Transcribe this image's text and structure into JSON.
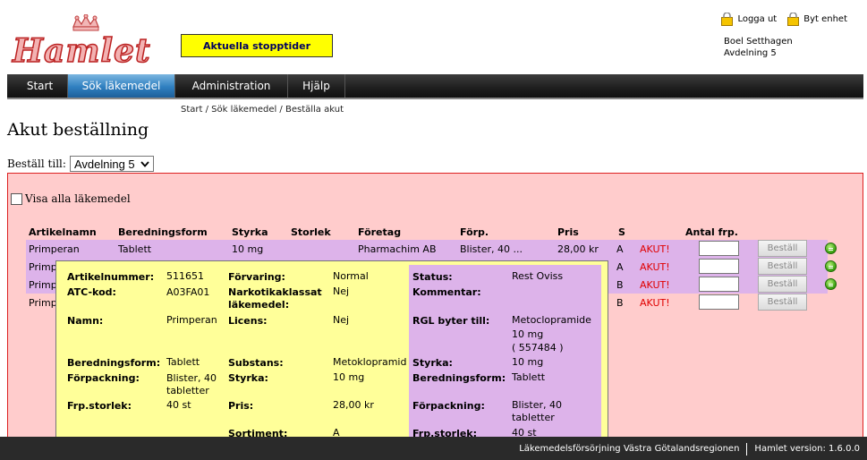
{
  "header": {
    "logo_text": "Hamlet",
    "stop_button": "Aktuella stopptider",
    "logout": "Logga ut",
    "switch_unit": "Byt enhet",
    "user_name": "Boel Setthagen",
    "user_unit": "Avdelning 5"
  },
  "nav": {
    "items": [
      {
        "label": "Start"
      },
      {
        "label": "Sök läkemedel"
      },
      {
        "label": "Administration"
      },
      {
        "label": "Hjälp"
      }
    ]
  },
  "breadcrumb": "Start / Sök läkemedel / Beställa akut",
  "page_title": "Akut beställning",
  "order_to": {
    "label": "Beställ till:",
    "selected": "Avdelning 5"
  },
  "show_all": "Visa alla läkemedel",
  "table": {
    "headers": {
      "artikelnamn": "Artikelnamn",
      "beredningsform": "Beredningsform",
      "styrka": "Styrka",
      "storlek": "Storlek",
      "foretag": "Företag",
      "forp": "Förp.",
      "pris": "Pris",
      "s": "S",
      "antal": "Antal frp."
    },
    "rows": [
      {
        "name": "Primperan",
        "form": "Tablett",
        "strength": "10 mg",
        "company": "Pharmachim AB",
        "pack": "Blister, 40 ...",
        "price": "28,00 kr",
        "s": "A",
        "akut": "AKUT!",
        "button": "Beställ"
      },
      {
        "name": "Primp",
        "s": "A",
        "akut": "AKUT!",
        "button": "Beställ"
      },
      {
        "name": "Primp",
        "s": "B",
        "akut": "AKUT!",
        "button": "Beställ"
      },
      {
        "name": "Primp",
        "s": "B",
        "akut": "AKUT!",
        "button": "Beställ"
      }
    ]
  },
  "popup": {
    "left": {
      "artikelnummer_label": "Artikelnummer:",
      "artikelnummer": "511651",
      "atc_label": "ATC-kod:",
      "atc": "A03FA01",
      "namn_label": "Namn:",
      "namn": "Primperan",
      "form_label": "Beredningsform:",
      "form": "Tablett",
      "pack_label": "Förpackning:",
      "pack_1": "Blister, 40",
      "pack_2": "tabletter",
      "size_label": "Frp.storlek:",
      "size": "40 st"
    },
    "middle": {
      "storage_label": "Förvaring:",
      "storage": "Normal",
      "narc_label_1": "Narkotikaklassat",
      "narc_label_2": "läkemedel:",
      "narc": "Nej",
      "license_label": "Licens:",
      "license": "Nej",
      "substance_label": "Substans:",
      "substance": "Metoklopramid",
      "strength_label": "Styrka:",
      "strength": "10 mg",
      "price_label": "Pris:",
      "price": "28,00 kr",
      "assortment_label": "Sortiment:",
      "assortment": "A"
    },
    "right": {
      "status_label": "Status:",
      "status": "Rest Oviss",
      "comment_label": "Kommentar:",
      "rgl_label": "RGL byter till:",
      "rgl_1": "Metoclopramide",
      "rgl_2": "10 mg",
      "rgl_3": "( 557484 )",
      "strength_label": "Styrka:",
      "strength": "10 mg",
      "form_label": "Beredningsform:",
      "form": "Tablett",
      "pack_label": "Förpackning:",
      "pack_1": "Blister, 40",
      "pack_2": "tabletter",
      "size_label": "Frp.storlek:",
      "size": "40 st"
    }
  },
  "footer": {
    "org": "Läkemedelsförsörjning Västra Götalandsregionen",
    "version": "Hamlet version: 1.6.0.0"
  },
  "colors": {
    "panel_bg": "#ffcccc",
    "row_highlight": "#ddb3ea",
    "popup_bg": "#ffff99",
    "akut": "#e00000",
    "nav_active": "#2f7fc0"
  }
}
